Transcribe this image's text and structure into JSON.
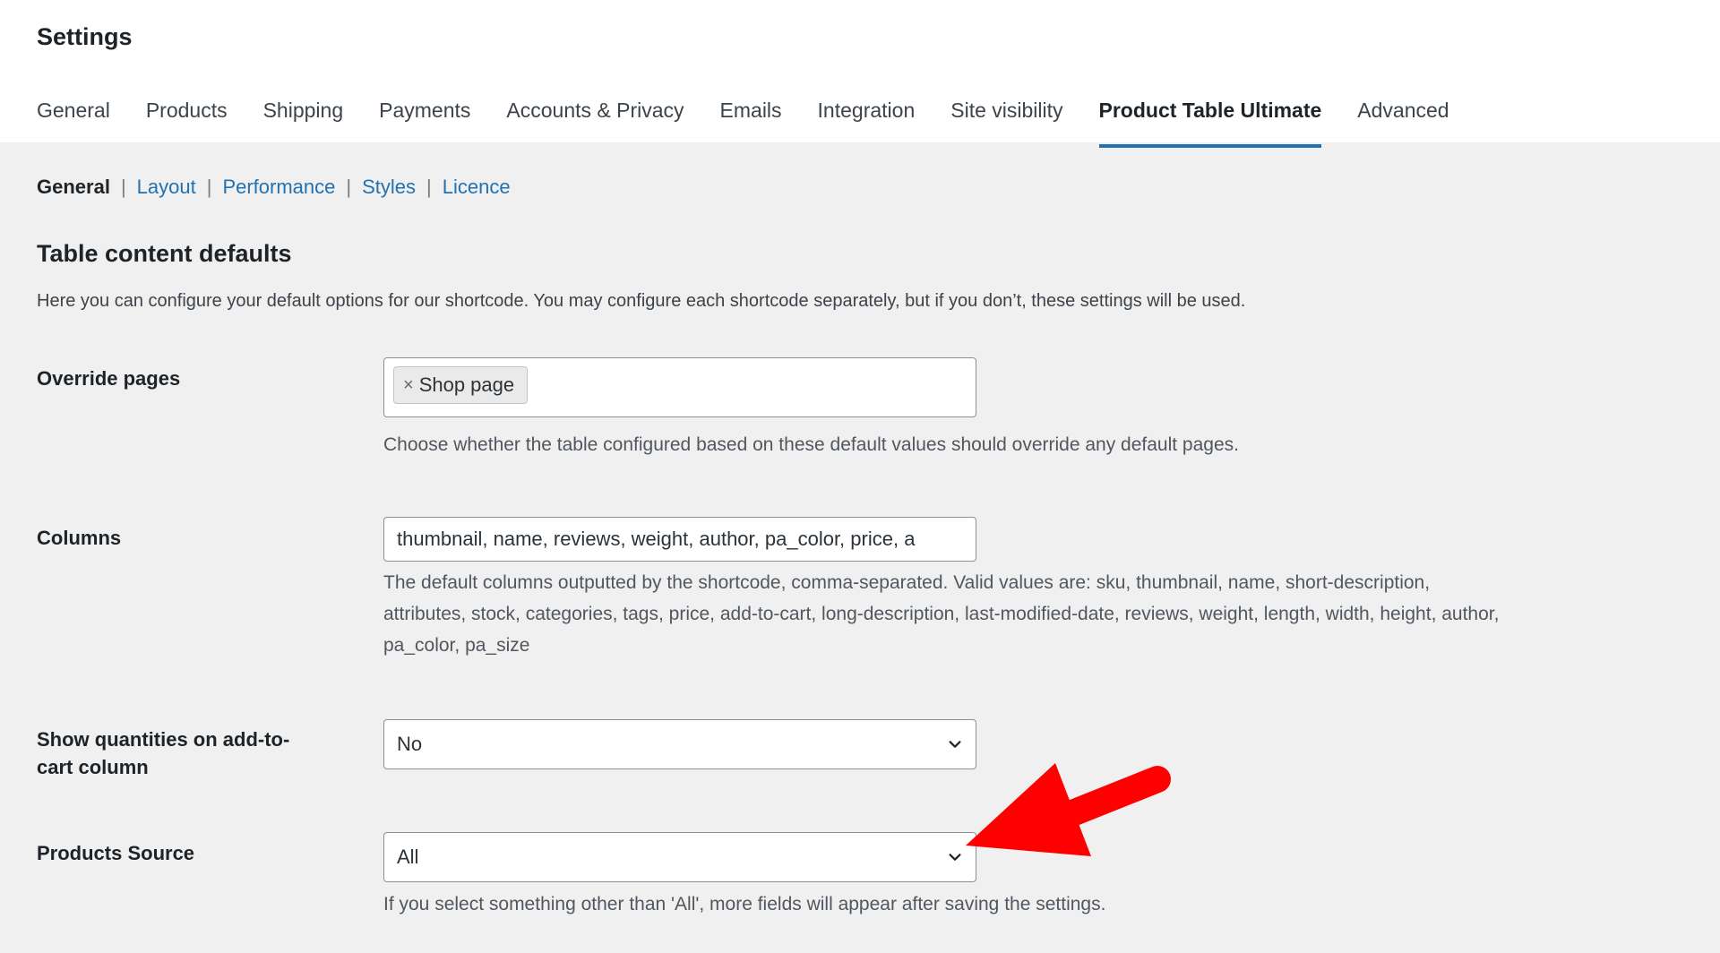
{
  "header": {
    "title": "Settings",
    "tabs": [
      {
        "label": "General"
      },
      {
        "label": "Products"
      },
      {
        "label": "Shipping"
      },
      {
        "label": "Payments"
      },
      {
        "label": "Accounts & Privacy"
      },
      {
        "label": "Emails"
      },
      {
        "label": "Integration"
      },
      {
        "label": "Site visibility"
      },
      {
        "label": "Product Table Ultimate",
        "active": true
      },
      {
        "label": "Advanced"
      }
    ]
  },
  "subnav": {
    "current": "General",
    "links": [
      "Layout",
      "Performance",
      "Styles",
      "Licence"
    ],
    "separator": "|"
  },
  "section": {
    "title": "Table content defaults",
    "description": "Here you can configure your default options for our shortcode. You may configure each shortcode separately, but if you don’t, these settings will be used."
  },
  "fields": {
    "override_pages": {
      "label": "Override pages",
      "chip_remove": "×",
      "chip_label": "Shop page",
      "help": "Choose whether the table configured based on these default values should override any default pages."
    },
    "columns": {
      "label": "Columns",
      "value": "thumbnail, name, reviews, weight, author, pa_color, price, a",
      "help_line1": "The default columns outputted by the shortcode, comma-separated. Valid values are: sku, thumbnail, name, short-description,",
      "help_line2": "attributes, stock, categories, tags, price, add-to-cart, long-description, last-modified-date, reviews, weight, length, width, height, author,",
      "help_line3": "pa_color, pa_size"
    },
    "show_quantities": {
      "label_line1": "Show quantities on add-to-",
      "label_line2": "cart column",
      "value": "No"
    },
    "products_source": {
      "label": "Products Source",
      "value": "All",
      "help": "If you select something other than 'All', more fields will appear after saving the settings."
    }
  },
  "colors": {
    "accent": "#2271b1",
    "annotation_arrow": "#ff0000"
  },
  "icons": {
    "select_chevron": "chevron-down-icon",
    "annotation": "red-arrow-icon"
  }
}
